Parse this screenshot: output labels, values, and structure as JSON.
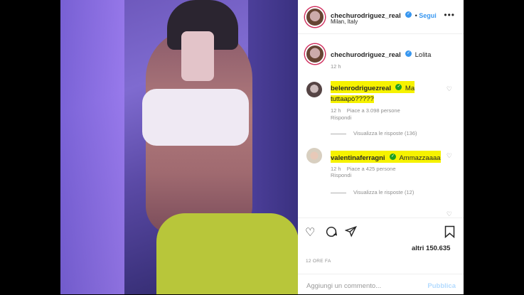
{
  "post": {
    "username": "chechurodriguez_real",
    "follow_label": "Segui",
    "location": "Milan, Italy",
    "caption": "Lolita",
    "caption_time": "12 h"
  },
  "comments": [
    {
      "username": "belenrodriguezreal",
      "text_line1": "Ma",
      "text_line2": "tuttaapò?????",
      "time": "12 h",
      "likes": "Piace a 3.098 persone",
      "reply": "Rispondi",
      "view_replies": "Visualizza le risposte (136)"
    },
    {
      "username": "valentinaferragni",
      "text": "Ammazzaaaa",
      "time": "12 h",
      "likes": "Piace a 425 persone",
      "reply": "Rispondi",
      "view_replies": "Visualizza le risposte (12)"
    }
  ],
  "footer": {
    "likes_count": "altri 150.635",
    "timestamp": "12 ORE FA",
    "comment_placeholder": "Aggiungi un commento...",
    "publish_label": "Pubblica"
  },
  "icons": {
    "more": "more-options-icon",
    "verified": "verified-badge-icon",
    "heart": "heart-icon",
    "comment": "comment-icon",
    "share": "share-icon",
    "save": "bookmark-icon"
  },
  "colors": {
    "accent": "#3897f0",
    "highlight": "#f6f200"
  }
}
